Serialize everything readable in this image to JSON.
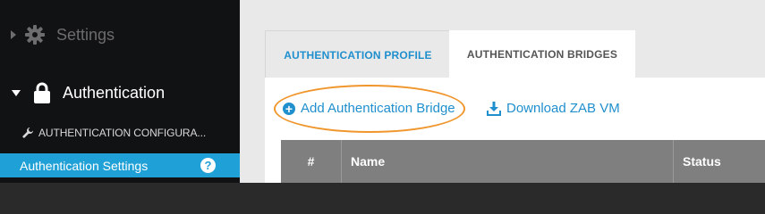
{
  "sidebar": {
    "settings_label": "Settings",
    "authentication_label": "Authentication",
    "auth_config_label": "AUTHENTICATION CONFIGURA...",
    "auth_settings_label": "Authentication Settings",
    "help_glyph": "?"
  },
  "tabs": {
    "profile_label": "AUTHENTICATION PROFILE",
    "bridges_label": "AUTHENTICATION BRIDGES",
    "active": "bridges"
  },
  "actions": {
    "add_bridge_label": "Add Authentication Bridge",
    "download_label": "Download ZAB VM"
  },
  "table": {
    "columns": [
      "#",
      "Name",
      "Status"
    ]
  },
  "colors": {
    "accent_blue": "#1fa0d6",
    "link_blue": "#1f8fcd",
    "highlight_orange": "#f0962d",
    "table_header": "#7f7f80"
  },
  "icons": [
    "caret-right-icon",
    "gear-icon",
    "caret-down-icon",
    "lock-icon",
    "wrench-icon",
    "help-icon",
    "plus-circle-icon",
    "download-icon"
  ]
}
